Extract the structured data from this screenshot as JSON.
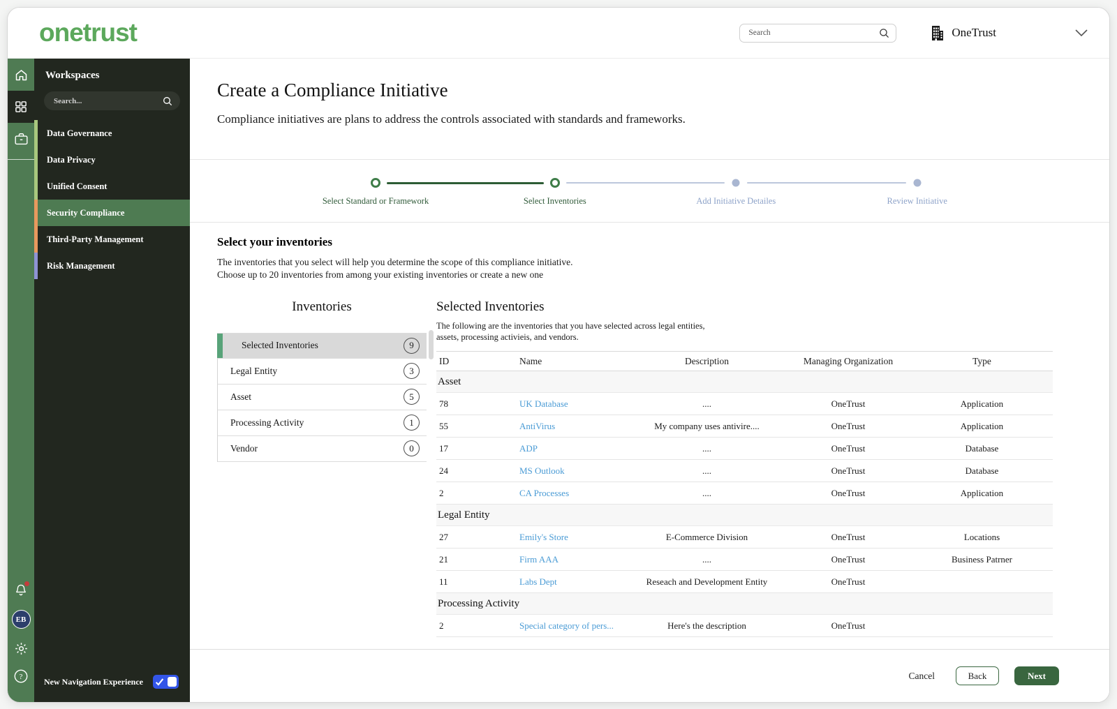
{
  "header": {
    "logo": "onetrust",
    "search_placeholder": "Search",
    "org_name": "OneTrust"
  },
  "sidebar": {
    "title": "Workspaces",
    "search_placeholder": "Search...",
    "items": [
      {
        "label": "Data Governance",
        "bar_color": "#a8c87e",
        "active": false
      },
      {
        "label": "Data Privacy",
        "bar_color": "#a8c87e",
        "active": false
      },
      {
        "label": "Unified Consent",
        "bar_color": "#a8c87e",
        "active": false
      },
      {
        "label": "Security Compliance",
        "bar_color": "#e8995e",
        "active": true
      },
      {
        "label": "Third-Party Management",
        "bar_color": "#e8995e",
        "active": false
      },
      {
        "label": "Risk Management",
        "bar_color": "#8e93d4",
        "active": false
      }
    ],
    "footer_toggle_label": "New Navigation Experience",
    "avatar_initials": "EB"
  },
  "page": {
    "title": "Create a Compliance Initiative",
    "subtitle": "Compliance initiatives are plans to address the controls associated with standards and frameworks."
  },
  "stepper": {
    "steps": [
      {
        "label": "Select Standard or Framework",
        "state": "done"
      },
      {
        "label": "Select Inventories",
        "state": "active"
      },
      {
        "label": "Add Initiative Detailes",
        "state": "todo"
      },
      {
        "label": "Review Initiative",
        "state": "todo"
      }
    ]
  },
  "section": {
    "title": "Select your inventories",
    "desc_line1": "The inventories that you select will help you determine the scope of this compliance initiative.",
    "desc_line2": "Choose up to 20 inventories from among your existing inventories or create a new one"
  },
  "inventories": {
    "title": "Inventories",
    "items": [
      {
        "label": "Selected Inventories",
        "count": "9",
        "selected": true
      },
      {
        "label": "Legal Entity",
        "count": "3",
        "selected": false
      },
      {
        "label": "Asset",
        "count": "5",
        "selected": false
      },
      {
        "label": "Processing Activity",
        "count": "1",
        "selected": false
      },
      {
        "label": "Vendor",
        "count": "0",
        "selected": false
      }
    ]
  },
  "selected_inventories": {
    "title": "Selected Inventories",
    "desc_line1": "The following are the inventories that you have selected across legal entities,",
    "desc_line2": "assets, processing activieis, and vendors.",
    "columns": [
      "ID",
      "Name",
      "Description",
      "Managing Organization",
      "Type"
    ],
    "groups": [
      {
        "name": "Asset",
        "rows": [
          {
            "id": "78",
            "name": "UK Database",
            "description": "....",
            "org": "OneTrust",
            "type": "Application"
          },
          {
            "id": "55",
            "name": "AntiVirus",
            "description": "My company uses antivire....",
            "org": "OneTrust",
            "type": "Application"
          },
          {
            "id": "17",
            "name": "ADP",
            "description": "....",
            "org": "OneTrust",
            "type": "Database"
          },
          {
            "id": "24",
            "name": "MS Outlook",
            "description": "....",
            "org": "OneTrust",
            "type": "Database"
          },
          {
            "id": "2",
            "name": "CA Processes",
            "description": "....",
            "org": "OneTrust",
            "type": "Application"
          }
        ]
      },
      {
        "name": "Legal Entity",
        "rows": [
          {
            "id": "27",
            "name": "Emily's Store",
            "description": "E-Commerce Division",
            "org": "OneTrust",
            "type": "Locations"
          },
          {
            "id": "21",
            "name": "Firm AAA",
            "description": "....",
            "org": "OneTrust",
            "type": "Business Patrner"
          },
          {
            "id": "11",
            "name": "Labs Dept",
            "description": "Reseach and Development Entity",
            "org": "OneTrust",
            "type": ""
          }
        ]
      },
      {
        "name": "Processing Activity",
        "rows": [
          {
            "id": "2",
            "name": "Special category of pers...",
            "description": "Here's the description",
            "org": "OneTrust",
            "type": ""
          }
        ]
      }
    ]
  },
  "footer": {
    "cancel_label": "Cancel",
    "back_label": "Back",
    "next_label": "Next"
  },
  "colors": {
    "brand_green": "#5ca85c",
    "rail_green": "#4f7b53",
    "sidebar_dark": "#22271f",
    "active_item_green": "#4e7b52",
    "stepper_done_green": "#2d5c35",
    "stepper_todo_gray": "#a9b6d1",
    "selected_bar_green": "#58a379",
    "link_blue": "#4a9bd5",
    "toggle_blue": "#3355e8",
    "button_green": "#39663f",
    "notification_red": "#c43c3c"
  }
}
